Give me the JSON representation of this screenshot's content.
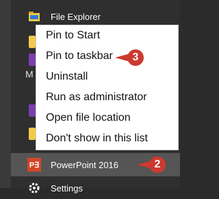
{
  "apps": {
    "file_explorer": {
      "label": "File Explorer",
      "icon": "folder-icon"
    },
    "powerpoint": {
      "label": "PowerPoint 2016",
      "icon": "powerpoint-icon",
      "icon_text": "P∃"
    },
    "settings": {
      "label": "Settings",
      "icon": "gear-icon"
    }
  },
  "group_letter": "M",
  "context_menu": {
    "items": [
      "Pin to Start",
      "Pin to taskbar",
      "Uninstall",
      "Run as administrator",
      "Open file location",
      "Don't show in this list"
    ]
  },
  "callouts": {
    "step_pin": "3",
    "step_app": "2"
  },
  "colors": {
    "accent_red": "#cc3a2f",
    "powerpoint_orange": "#d24726",
    "explorer_yellow": "#f2c94c",
    "app_tile_purple": "#7b3fb0"
  }
}
